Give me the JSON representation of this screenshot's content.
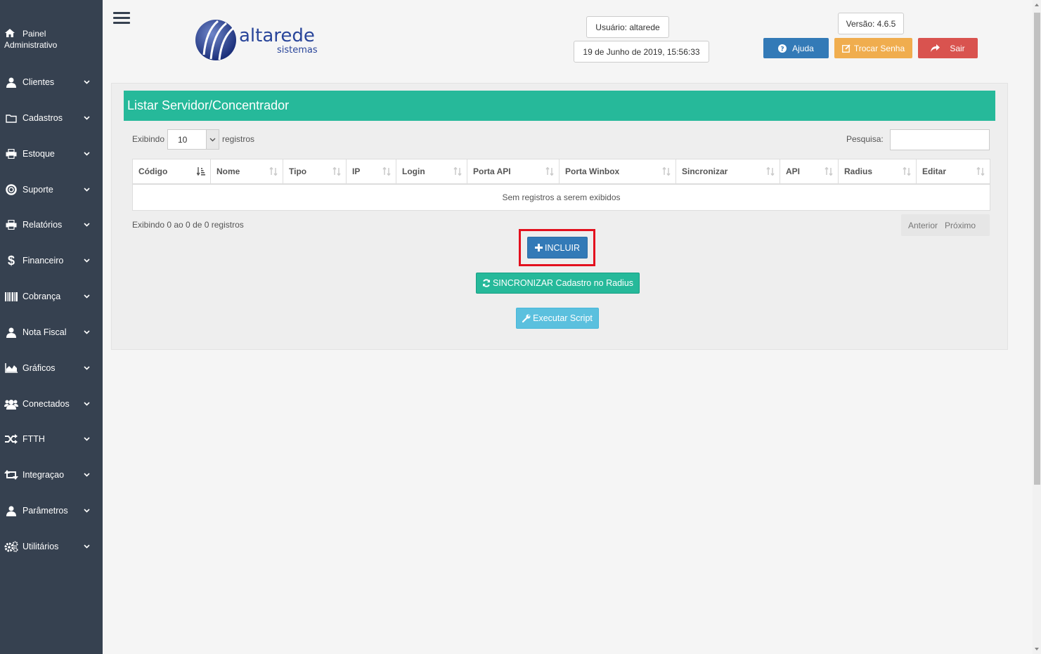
{
  "sidebar": {
    "home": {
      "line1": "Painel",
      "line2": "Administrativo",
      "icon": "home-icon"
    },
    "items": [
      {
        "label": "Clientes",
        "icon": "user-icon"
      },
      {
        "label": "Cadastros",
        "icon": "folder-icon"
      },
      {
        "label": "Estoque",
        "icon": "print-icon"
      },
      {
        "label": "Suporte",
        "icon": "lifebuoy-icon"
      },
      {
        "label": "Relatórios",
        "icon": "print-icon"
      },
      {
        "label": "Financeiro",
        "icon": "dollar-icon"
      },
      {
        "label": "Cobrança",
        "icon": "barcode-icon"
      },
      {
        "label": "Nota Fiscal",
        "icon": "user-icon"
      },
      {
        "label": "Gráficos",
        "icon": "area-chart-icon"
      },
      {
        "label": "Conectados",
        "icon": "users-icon"
      },
      {
        "label": "FTTH",
        "icon": "random-icon"
      },
      {
        "label": "Integraçao",
        "icon": "retweet-icon"
      },
      {
        "label": "Parâmetros",
        "icon": "user-icon"
      },
      {
        "label": "Utilitários",
        "icon": "cogs-icon"
      }
    ]
  },
  "header": {
    "logo_text": "altarede",
    "logo_subtext": "sistemas",
    "user": "Usuário: altarede",
    "datetime": "19 de Junho de 2019, 15:56:33",
    "version": "Versão: 4.6.5",
    "help_label": "Ajuda",
    "change_password_label": "Trocar Senha",
    "logout_label": "Sair"
  },
  "panel": {
    "title": "Listar Servidor/Concentrador",
    "show_label": "Exibindo",
    "page_size": "10",
    "records_label": "registros",
    "search_label": "Pesquisa:",
    "search_value": "",
    "columns": [
      "Código",
      "Nome",
      "Tipo",
      "IP",
      "Login",
      "Porta API",
      "Porta Winbox",
      "Sincronizar",
      "API",
      "Radius",
      "Editar"
    ],
    "empty_message": "Sem registros a serem exibidos",
    "info": "Exibindo 0 ao 0 de 0 registros",
    "prev_label": "Anterior",
    "next_label": "Próximo",
    "include_label": "INCLUIR",
    "sync_label": "SINCRONIZAR Cadastro no Radius",
    "script_label": "Executar Script"
  },
  "colors": {
    "sidebar_bg": "#364150",
    "title_bg": "#26b99a",
    "primary": "#337ab7",
    "warning": "#f0ad4e",
    "danger": "#d9534f",
    "info": "#5bc0de",
    "highlight": "#e3101e"
  }
}
